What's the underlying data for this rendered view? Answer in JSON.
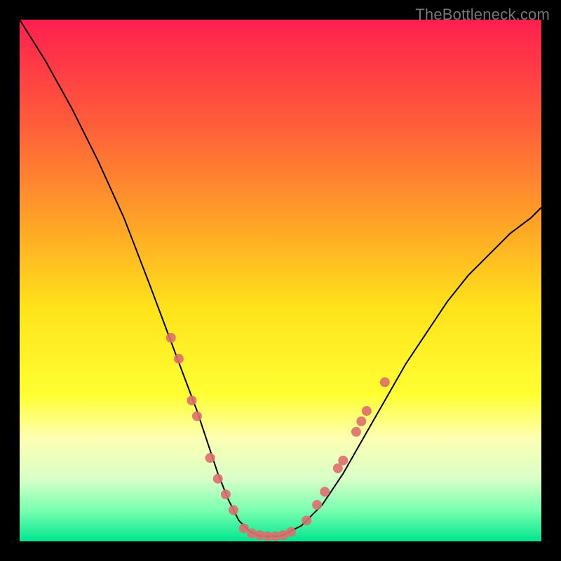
{
  "watermark": "TheBottleneck.com",
  "chart_data": {
    "type": "line",
    "title": "",
    "xlabel": "",
    "ylabel": "",
    "xlim": [
      0,
      100
    ],
    "ylim": [
      0,
      100
    ],
    "series": [
      {
        "name": "curve",
        "x": [
          0,
          5,
          10,
          15,
          20,
          25,
          28,
          31,
          34,
          36,
          38,
          40,
          42,
          44,
          46,
          48,
          50,
          54,
          58,
          62,
          66,
          70,
          74,
          78,
          82,
          86,
          90,
          94,
          98,
          100
        ],
        "y": [
          100,
          92,
          83,
          73,
          62,
          49,
          41,
          33,
          25,
          19,
          13,
          8,
          4,
          2,
          1,
          1,
          1,
          3,
          7,
          13,
          20,
          27,
          34,
          40,
          46,
          51,
          55,
          59,
          62,
          64
        ]
      }
    ],
    "markers": [
      {
        "x": 29.0,
        "y": 39.0
      },
      {
        "x": 30.5,
        "y": 35.0
      },
      {
        "x": 33.0,
        "y": 27.0
      },
      {
        "x": 34.0,
        "y": 24.0
      },
      {
        "x": 36.5,
        "y": 16.0
      },
      {
        "x": 38.0,
        "y": 12.0
      },
      {
        "x": 39.5,
        "y": 9.0
      },
      {
        "x": 41.0,
        "y": 6.0
      },
      {
        "x": 43.0,
        "y": 2.5
      },
      {
        "x": 44.5,
        "y": 1.5
      },
      {
        "x": 46.0,
        "y": 1.2
      },
      {
        "x": 47.5,
        "y": 1.0
      },
      {
        "x": 49.0,
        "y": 1.0
      },
      {
        "x": 50.5,
        "y": 1.2
      },
      {
        "x": 52.0,
        "y": 1.8
      },
      {
        "x": 55.0,
        "y": 4.0
      },
      {
        "x": 57.0,
        "y": 7.0
      },
      {
        "x": 58.5,
        "y": 9.5
      },
      {
        "x": 61.0,
        "y": 14.0
      },
      {
        "x": 62.0,
        "y": 15.5
      },
      {
        "x": 64.5,
        "y": 21.0
      },
      {
        "x": 65.5,
        "y": 23.0
      },
      {
        "x": 66.5,
        "y": 25.0
      },
      {
        "x": 70.0,
        "y": 30.5
      }
    ],
    "gradient_stops": [
      {
        "pos": 0.0,
        "color": "#ff1f4f"
      },
      {
        "pos": 0.2,
        "color": "#ff5d3a"
      },
      {
        "pos": 0.4,
        "color": "#ffa726"
      },
      {
        "pos": 0.55,
        "color": "#ffe21a"
      },
      {
        "pos": 0.72,
        "color": "#ffff33"
      },
      {
        "pos": 0.8,
        "color": "#fdffb0"
      },
      {
        "pos": 0.88,
        "color": "#d9ffc8"
      },
      {
        "pos": 0.94,
        "color": "#7affb0"
      },
      {
        "pos": 1.0,
        "color": "#00e690"
      }
    ]
  }
}
